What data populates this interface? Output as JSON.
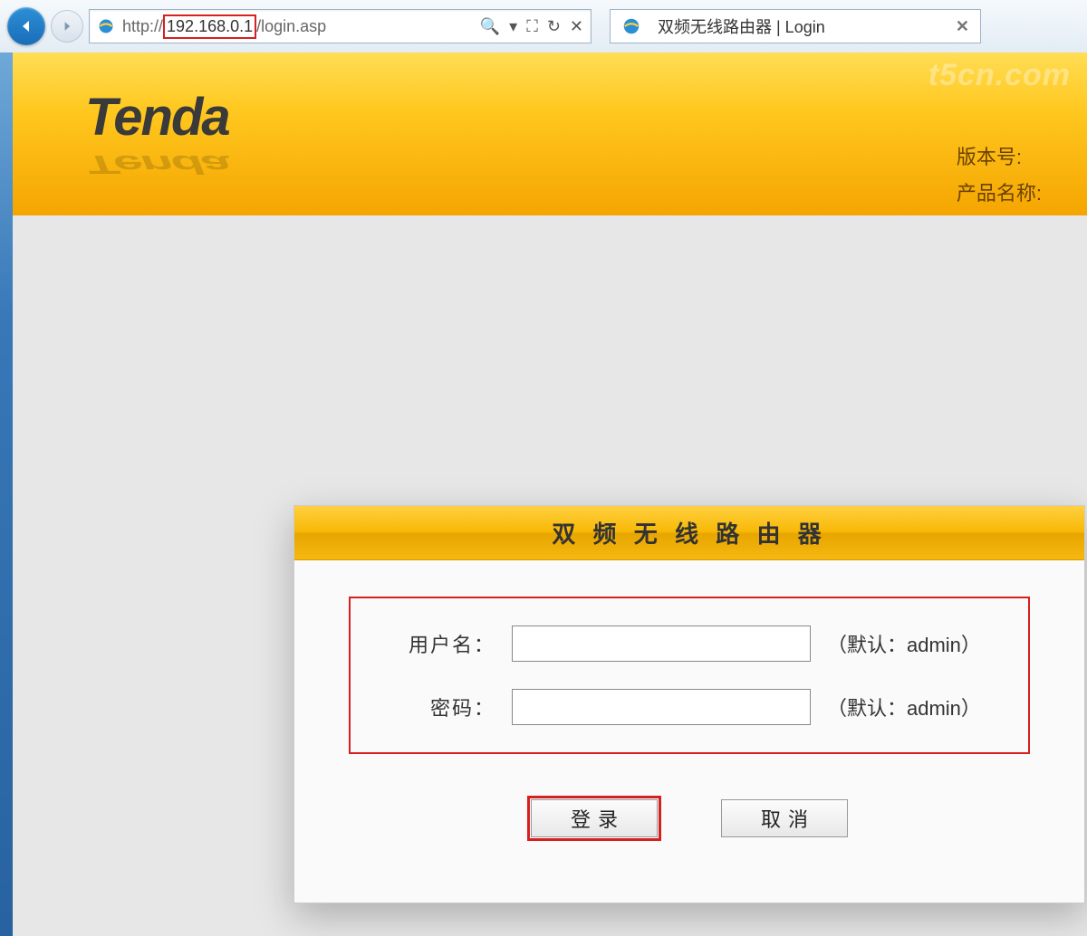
{
  "browser": {
    "url_prefix": "http://",
    "url_ip": "192.168.0.1",
    "url_suffix": "/login.asp",
    "tab_title": "双频无线路由器 | Login",
    "search_glyph": "🔍",
    "dropdown_glyph": "▾",
    "compat_glyph": "⛶",
    "refresh_glyph": "↻",
    "stop_glyph": "✕",
    "tab_close_glyph": "✕"
  },
  "banner": {
    "logo_text": "Tenda",
    "version_label": "版本号:",
    "product_label": "产品名称:",
    "watermark": "t5cn.com"
  },
  "login": {
    "title": "双 频 无 线 路 由 器",
    "username_label": "用户名：",
    "username_hint": "（默认：admin）",
    "username_value": "",
    "password_label": "密码：",
    "password_hint": "（默认：admin）",
    "password_value": "",
    "submit_label": "登录",
    "cancel_label": "取消"
  }
}
